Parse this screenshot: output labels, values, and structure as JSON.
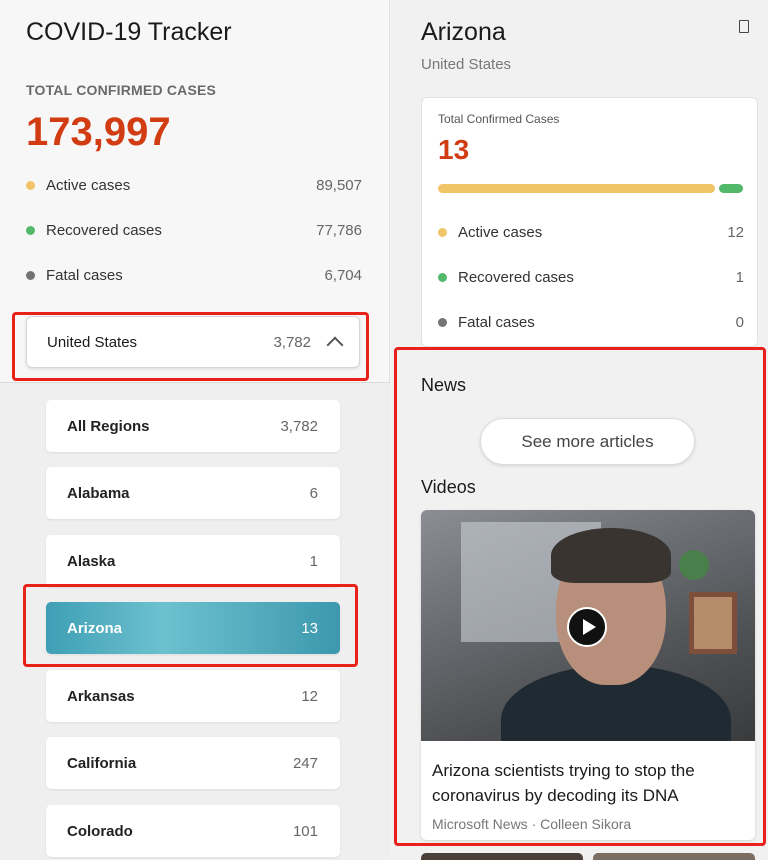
{
  "app": {
    "title": "COVID-19 Tracker"
  },
  "global": {
    "total_label": "TOTAL CONFIRMED CASES",
    "total_value": "173,997",
    "stats": [
      {
        "label": "Active cases",
        "value": "89,507",
        "color": "#f1c468"
      },
      {
        "label": "Recovered cases",
        "value": "77,786",
        "color": "#53b96a"
      },
      {
        "label": "Fatal cases",
        "value": "6,704",
        "color": "#737373"
      }
    ]
  },
  "country_select": {
    "name": "United States",
    "count": "3,782",
    "icon": "chevron-up-icon"
  },
  "regions": [
    {
      "name": "All Regions",
      "count": "3,782",
      "selected": false
    },
    {
      "name": "Alabama",
      "count": "6",
      "selected": false
    },
    {
      "name": "Alaska",
      "count": "1",
      "selected": false
    },
    {
      "name": "Arizona",
      "count": "13",
      "selected": true
    },
    {
      "name": "Arkansas",
      "count": "12",
      "selected": false
    },
    {
      "name": "California",
      "count": "247",
      "selected": false
    },
    {
      "name": "Colorado",
      "count": "101",
      "selected": false
    }
  ],
  "detail": {
    "title": "Arizona",
    "subtitle": "United States",
    "card": {
      "label": "Total Confirmed Cases",
      "value": "13",
      "active_fraction": 0.92,
      "stats": [
        {
          "label": "Active cases",
          "value": "12",
          "color": "#f1c468"
        },
        {
          "label": "Recovered cases",
          "value": "1",
          "color": "#53b96a"
        },
        {
          "label": "Fatal cases",
          "value": "0",
          "color": "#737373"
        }
      ]
    },
    "news_title": "News",
    "more_button": "See more articles",
    "videos_title": "Videos",
    "video": {
      "title": "Arizona scientists trying to stop the coronavirus by decoding its DNA",
      "source": "Microsoft News · Colleen Sikora"
    }
  },
  "colors": {
    "accent": "#d23c12",
    "selected": "#4aa8bb",
    "highlight": "#e8221b"
  }
}
